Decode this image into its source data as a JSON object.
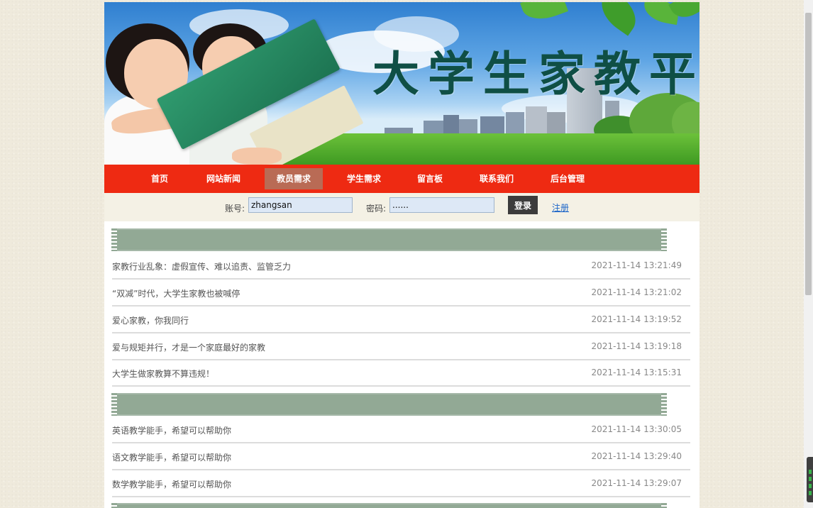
{
  "banner": {
    "title": "大学生家教平台"
  },
  "nav": {
    "items": [
      "首页",
      "网站新闻",
      "教员需求",
      "学生需求",
      "留言板",
      "联系我们",
      "后台管理"
    ],
    "active": "教员需求"
  },
  "login": {
    "account_label": "账号:",
    "account_value": "zhangsan",
    "password_label": "密码:",
    "password_value": "......",
    "login_button": "登录",
    "register_link": "注册"
  },
  "sections": [
    {
      "rows": [
        {
          "title": "家教行业乱象：虚假宣传、难以追责、监管乏力",
          "date": "2021-11-14 13:21:49"
        },
        {
          "title": "“双减”时代，大学生家教也被喊停",
          "date": "2021-11-14 13:21:02"
        },
        {
          "title": "爱心家教，你我同行",
          "date": "2021-11-14 13:19:52"
        },
        {
          "title": "爱与规矩并行，才是一个家庭最好的家教",
          "date": "2021-11-14 13:19:18"
        },
        {
          "title": "大学生做家教算不算违规！",
          "date": "2021-11-14 13:15:31"
        }
      ]
    },
    {
      "rows": [
        {
          "title": "英语教学能手，希望可以帮助你",
          "date": "2021-11-14 13:30:05"
        },
        {
          "title": "语文教学能手，希望可以帮助你",
          "date": "2021-11-14 13:29:40"
        },
        {
          "title": "数学教学能手，希望可以帮助你",
          "date": "2021-11-14 13:29:07"
        }
      ]
    }
  ],
  "colors": {
    "nav_bg": "#ee2a12",
    "nav_active": "#b96b55",
    "section_bar": "#92a995",
    "title_text": "#0f4f45",
    "link": "#1a64c8"
  },
  "icons": [
    "scrollbar-thumb",
    "system-tray-widget"
  ]
}
